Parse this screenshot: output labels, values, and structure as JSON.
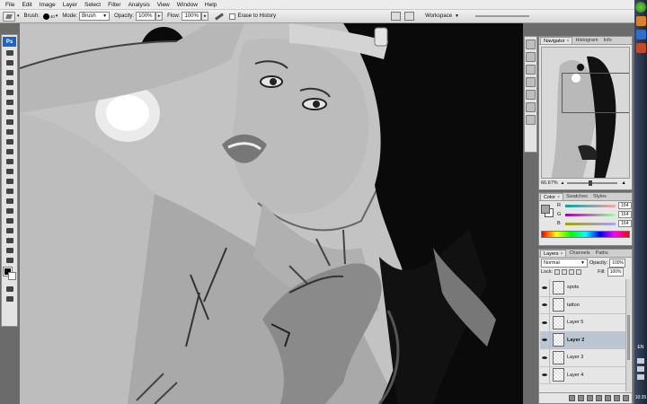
{
  "menu": [
    "File",
    "Edit",
    "Image",
    "Layer",
    "Select",
    "Filter",
    "Analysis",
    "View",
    "Window",
    "Help"
  ],
  "options": {
    "brush_label": "Brush:",
    "brush_size": "40",
    "mode_label": "Mode:",
    "mode_value": "Brush",
    "opacity_label": "Opacity:",
    "opacity_value": "100%",
    "flow_label": "Flow:",
    "flow_value": "100%",
    "erase_history_label": "Erase to History",
    "workspace_label": "Workspace"
  },
  "toolbox": {
    "logo": "Ps"
  },
  "navigator": {
    "tabs": [
      "Navigator",
      "Histogram",
      "Info"
    ],
    "zoom": "66.67%"
  },
  "color": {
    "tabs": [
      "Color",
      "Swatches",
      "Styles"
    ],
    "channels": [
      {
        "label": "R",
        "value": "164"
      },
      {
        "label": "G",
        "value": "164"
      },
      {
        "label": "B",
        "value": "164"
      }
    ],
    "fg_color": "#a4a4a4"
  },
  "layers": {
    "tabs": [
      "Layers",
      "Channels",
      "Paths"
    ],
    "blend_mode": "Normal",
    "opacity_label": "Opacity:",
    "opacity_value": "100%",
    "lock_label": "Lock:",
    "fill_label": "Fill:",
    "fill_value": "100%",
    "items": [
      {
        "name": "spots",
        "active": false
      },
      {
        "name": "tattoo",
        "active": false
      },
      {
        "name": "Layer 5",
        "active": false
      },
      {
        "name": "Layer 2",
        "active": true
      },
      {
        "name": "Layer 3",
        "active": false
      },
      {
        "name": "Layer 4",
        "active": false
      }
    ]
  },
  "taskbar": {
    "lang": "EN",
    "clock": "10:35"
  },
  "colors": {
    "accent_red": "#e02020",
    "active_layer": "#bcc5d2"
  }
}
